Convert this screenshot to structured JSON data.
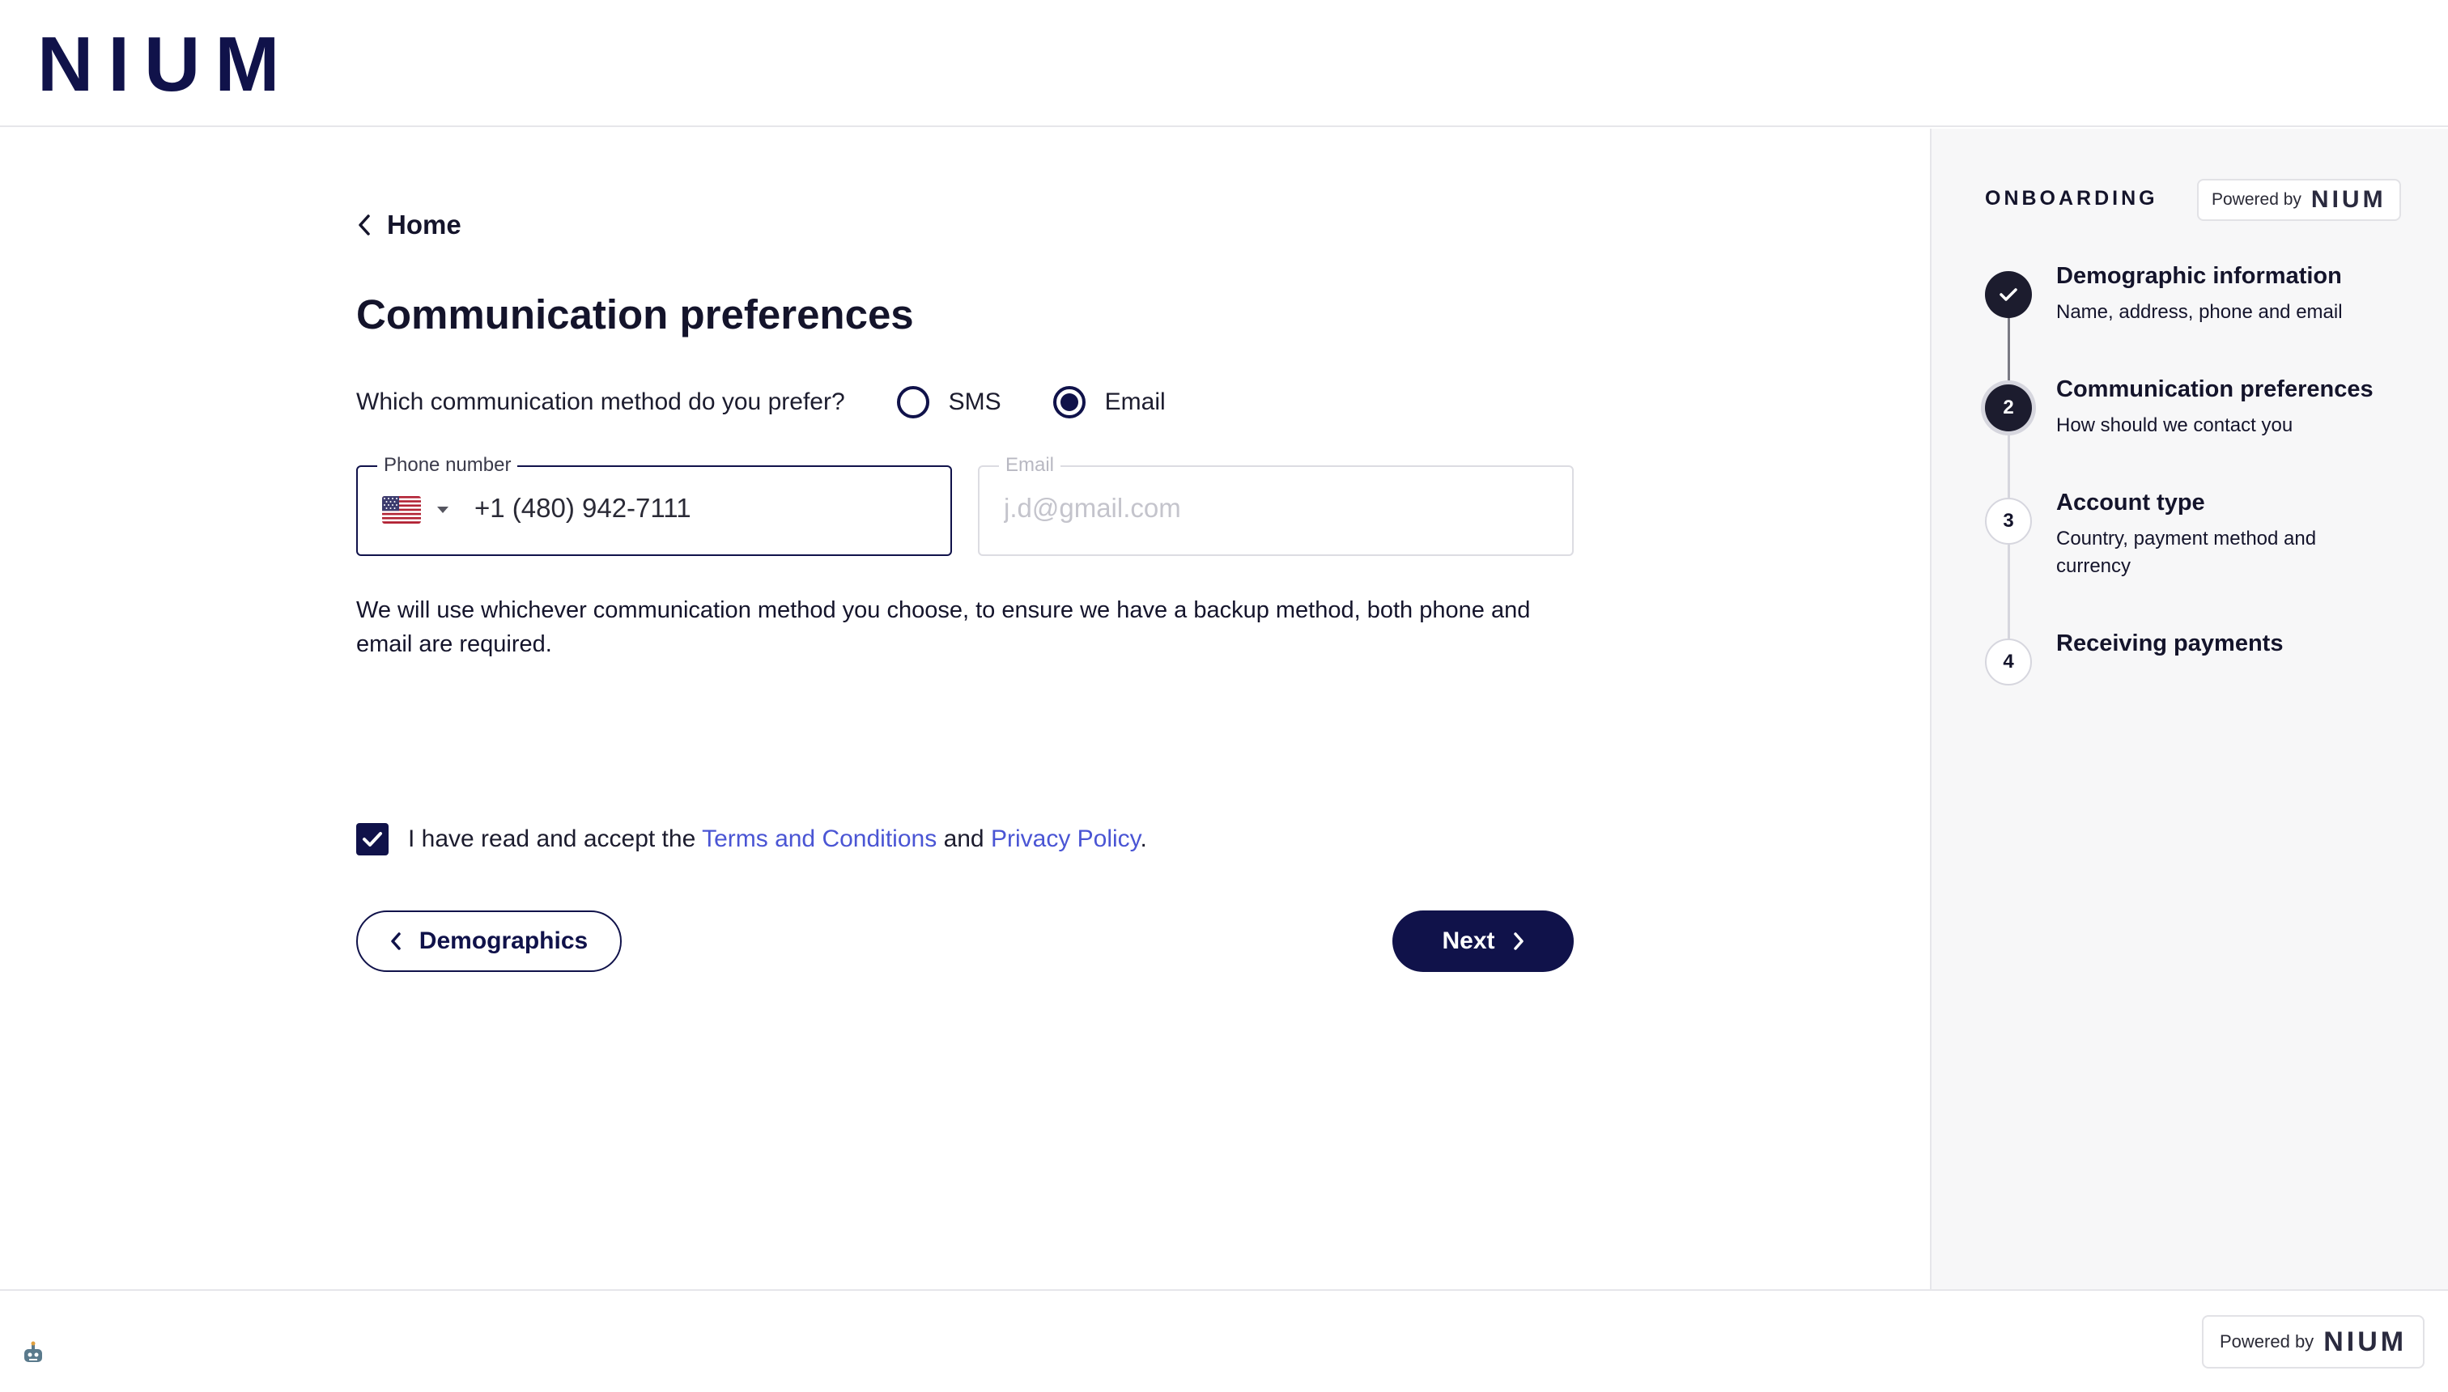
{
  "header": {
    "logo_text": "NIUM"
  },
  "main": {
    "back_label": "Home",
    "title": "Communication preferences",
    "question": "Which communication method do you prefer?",
    "methods": [
      {
        "label": "SMS",
        "selected": false
      },
      {
        "label": "Email",
        "selected": true
      }
    ],
    "phone": {
      "label": "Phone number",
      "country": "US",
      "value": "+1 (480) 942-7111"
    },
    "email": {
      "label": "Email",
      "placeholder": "j.d@gmail.com",
      "value": ""
    },
    "notice": "We will use whichever communication method you choose, to ensure we have a backup method, both phone and email are required.",
    "terms": {
      "checked": true,
      "prefix": "I have read and accept the",
      "terms_link": "Terms and Conditions",
      "and": "and",
      "privacy_link": "Privacy Policy",
      "suffix": "."
    },
    "back_button": "Demographics",
    "next_button": "Next"
  },
  "sidebar": {
    "title": "ONBOARDING",
    "powered_by": "Powered by",
    "powered_logo": "NIUM",
    "steps": [
      {
        "number": "",
        "status": "done",
        "title": "Demographic information",
        "desc": "Name, address, phone and email"
      },
      {
        "number": "2",
        "status": "active",
        "title": "Communication preferences",
        "desc": "How should we contact you"
      },
      {
        "number": "3",
        "status": "todo",
        "title": "Account type",
        "desc": "Country, payment method and currency"
      },
      {
        "number": "4",
        "status": "todo",
        "title": "Receiving payments",
        "desc": ""
      }
    ]
  },
  "footer": {
    "powered_by": "Powered by",
    "powered_logo": "NIUM"
  },
  "colors": {
    "brand": "#10124a",
    "link": "#4a55d4",
    "sidebar_bg": "#f7f7f8"
  },
  "icons": [
    "chevron-left-icon",
    "us-flag-icon",
    "caret-down-icon",
    "check-icon",
    "chevron-right-icon",
    "robot-icon"
  ]
}
